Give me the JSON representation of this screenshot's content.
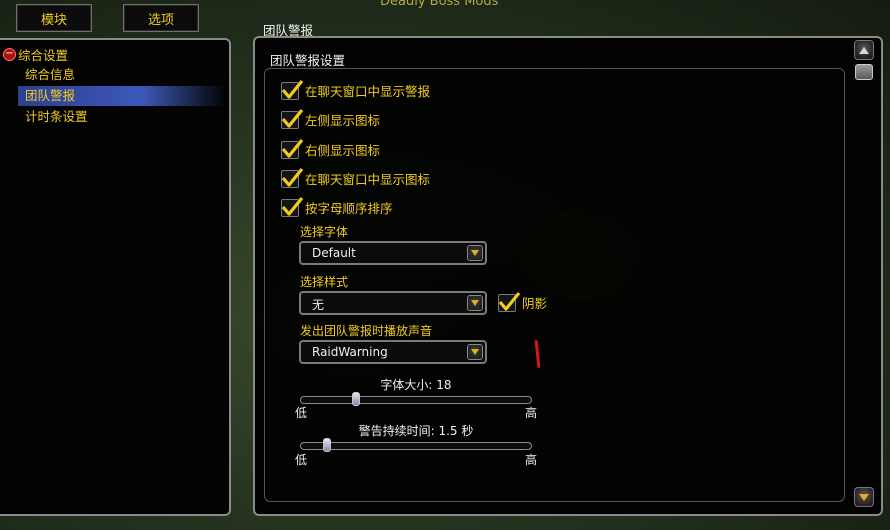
{
  "window": {
    "title": "Deadly Boss Mods"
  },
  "tabs": [
    {
      "label": "模块"
    },
    {
      "label": "选项"
    }
  ],
  "tree": {
    "root_label": "综合设置",
    "items": [
      {
        "label": "综合信息",
        "selected": false
      },
      {
        "label": "团队警报",
        "selected": true
      },
      {
        "label": "计时条设置",
        "selected": false
      }
    ]
  },
  "panel": {
    "title": "团队警报",
    "group_title": "团队警报设置"
  },
  "checkboxes": [
    {
      "label": "在聊天窗口中显示警报",
      "checked": true
    },
    {
      "label": "左侧显示图标",
      "checked": true
    },
    {
      "label": "右侧显示图标",
      "checked": true
    },
    {
      "label": "在聊天窗口中显示图标",
      "checked": true
    },
    {
      "label": "按字母顺序排序",
      "checked": true
    }
  ],
  "font_dropdown": {
    "label": "选择字体",
    "value": "Default"
  },
  "style_dropdown": {
    "label": "选择样式",
    "value": "无"
  },
  "shadow_checkbox": {
    "label": "阴影",
    "checked": true
  },
  "sound_dropdown": {
    "label": "发出团队警报时播放声音",
    "value": "RaidWarning"
  },
  "font_size_slider": {
    "title": "字体大小: 18",
    "low": "低",
    "high": "高",
    "fraction": 0.23
  },
  "duration_slider": {
    "title": "警告持续时间: 1.5 秒",
    "low": "低",
    "high": "高",
    "fraction": 0.1
  },
  "colors": {
    "accent_gold": "#f1cc1f",
    "selection_blue": "#3d58b8",
    "frame_gray": "#8a8a8a"
  },
  "icons": {
    "checkmark": "checkmark-icon",
    "collapse": "minus-icon",
    "dropdown": "dropdown-arrow-icon"
  }
}
